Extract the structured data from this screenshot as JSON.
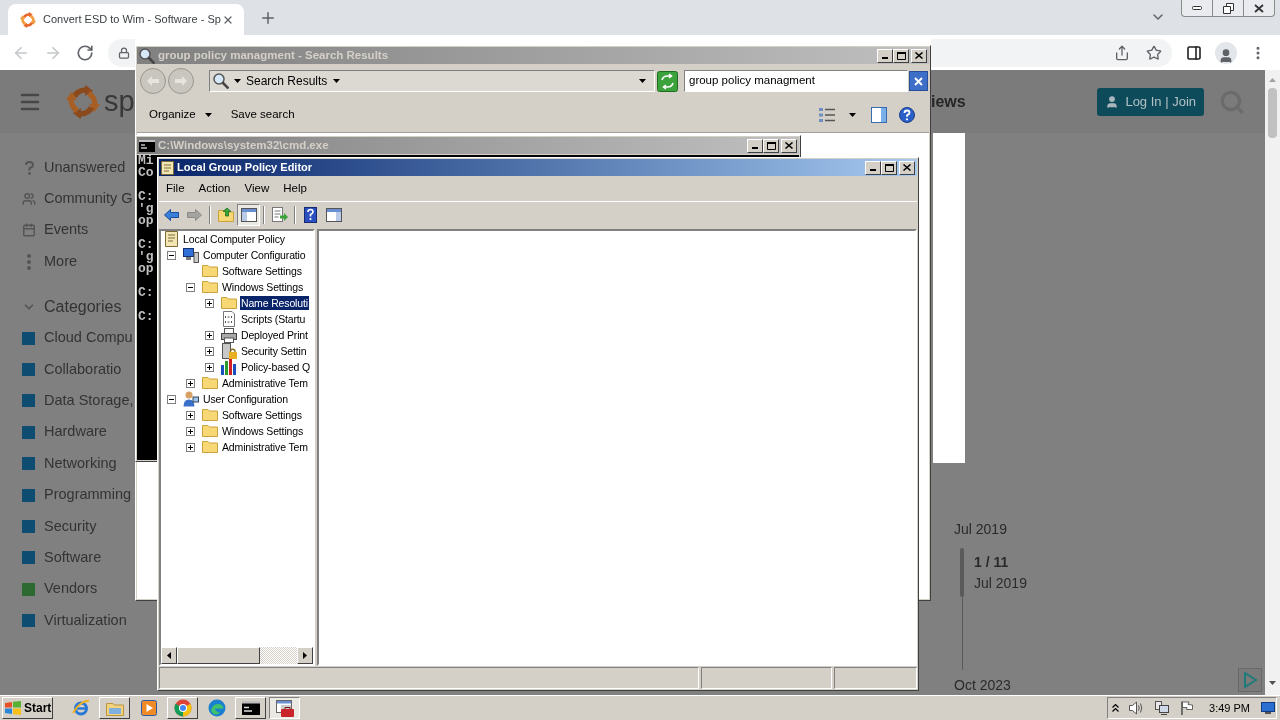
{
  "browser": {
    "tab": {
      "title": "Convert ESD to Wim - Software - Sp"
    },
    "nav": [
      {
        "kind": "back",
        "disabled": true
      },
      {
        "kind": "forward",
        "disabled": true
      },
      {
        "kind": "reload",
        "disabled": false
      }
    ]
  },
  "page": {
    "logo_text": "sp",
    "nav_link": "iews",
    "login_button": "Log In | Join",
    "sidebar": {
      "links": [
        {
          "kind": "question",
          "label": "Unanswered"
        },
        {
          "kind": "people",
          "label": "Community G"
        },
        {
          "kind": "calendar",
          "label": "Events"
        },
        {
          "kind": "more",
          "label": "More"
        }
      ],
      "categories": {
        "heading": "Categories",
        "expanded": true,
        "items": [
          {
            "label": "Cloud Compu",
            "color": "#0f4c72"
          },
          {
            "label": "Collaboratio",
            "color": "#0f4c72"
          },
          {
            "label": "Data Storage,",
            "color": "#0f4c72"
          },
          {
            "label": "Hardware",
            "color": "#0f4c72"
          },
          {
            "label": "Networking",
            "color": "#0f4c72"
          },
          {
            "label": "Programming",
            "color": "#0f4c72"
          },
          {
            "label": "Security",
            "color": "#0f4c72"
          },
          {
            "label": "Software",
            "color": "#0f4c72"
          },
          {
            "label": "Vendors",
            "color": "#2c6a32"
          },
          {
            "label": "Virtualization",
            "color": "#0f4c72"
          }
        ]
      }
    },
    "timeline": {
      "start": "Jul 2019",
      "counter": "1 / 11",
      "current": "Jul 2019",
      "end": "Oct 2023"
    }
  },
  "explorer": {
    "title": "group policy managment - Search Results",
    "active": false,
    "nav": [
      {
        "kind": "back",
        "disabled": true
      },
      {
        "kind": "forward",
        "disabled": true
      }
    ],
    "address": "Search Results",
    "search": {
      "value": "group policy managment"
    },
    "commands": [
      {
        "label": "Organize",
        "menu": true
      },
      {
        "label": "Save search",
        "menu": false
      }
    ]
  },
  "cmd": {
    "title": "C:\\Windows\\system32\\cmd.exe",
    "active": false,
    "blocks": [
      [
        "Mi",
        "Co"
      ],
      [
        "C:",
        "'g",
        "op"
      ],
      [
        "C:",
        "'g",
        "op"
      ],
      [
        "C:"
      ],
      [
        "C:"
      ]
    ]
  },
  "gpedit": {
    "title": "Local Group Policy Editor",
    "active": true,
    "menu": [
      "File",
      "Action",
      "View",
      "Help"
    ],
    "toolbar": [
      [
        {
          "kind": "back",
          "disabled": false,
          "pressed": false
        },
        {
          "kind": "forward",
          "disabled": true,
          "pressed": false
        }
      ],
      [
        {
          "kind": "up",
          "disabled": false,
          "pressed": false
        },
        {
          "kind": "tree",
          "disabled": false,
          "pressed": true
        }
      ],
      [
        {
          "kind": "export",
          "disabled": false,
          "pressed": false
        }
      ],
      [
        {
          "kind": "help",
          "disabled": false,
          "pressed": false
        },
        {
          "kind": "pane",
          "disabled": false,
          "pressed": false
        }
      ]
    ],
    "tree": [
      {
        "label": "Local Computer Policy",
        "kind": "policy",
        "selected": false,
        "children": [
          {
            "label": "Computer Configuratio",
            "kind": "computer",
            "expanded": true,
            "selected": false,
            "children": [
              {
                "label": "Software Settings",
                "kind": "folder",
                "selected": false
              },
              {
                "label": "Windows Settings",
                "kind": "folder",
                "expanded": true,
                "selected": false,
                "children": [
                  {
                    "label": "Name Resoluti",
                    "kind": "folder",
                    "expanded": false,
                    "selected": true
                  },
                  {
                    "label": "Scripts (Startu",
                    "kind": "script",
                    "selected": false
                  },
                  {
                    "label": "Deployed Print",
                    "kind": "printer",
                    "expanded": false,
                    "selected": false
                  },
                  {
                    "label": "Security Settin",
                    "kind": "security",
                    "expanded": false,
                    "selected": false
                  },
                  {
                    "label": "Policy-based Q",
                    "kind": "chart",
                    "expanded": false,
                    "selected": false
                  }
                ]
              },
              {
                "label": "Administrative Tem",
                "kind": "folder",
                "expanded": false,
                "selected": false
              }
            ]
          },
          {
            "label": "User Configuration",
            "kind": "user",
            "expanded": true,
            "selected": false,
            "children": [
              {
                "label": "Software Settings",
                "kind": "folder",
                "expanded": false,
                "selected": false
              },
              {
                "label": "Windows Settings",
                "kind": "folder",
                "expanded": false,
                "selected": false
              },
              {
                "label": "Administrative Tem",
                "kind": "folder",
                "expanded": false,
                "selected": false
              }
            ]
          }
        ]
      }
    ]
  },
  "taskbar": {
    "start": "Start",
    "items": [
      {
        "kind": "ie",
        "running": false,
        "selected": false
      },
      {
        "kind": "folder",
        "running": true,
        "selected": false
      },
      {
        "kind": "media",
        "running": false,
        "selected": false
      },
      {
        "kind": "chrome",
        "running": true,
        "selected": false
      },
      {
        "kind": "edge",
        "running": false,
        "selected": false
      },
      {
        "kind": "console",
        "running": true,
        "selected": false
      },
      {
        "kind": "editor",
        "running": true,
        "selected": true
      }
    ],
    "clock": "3:49 PM"
  }
}
